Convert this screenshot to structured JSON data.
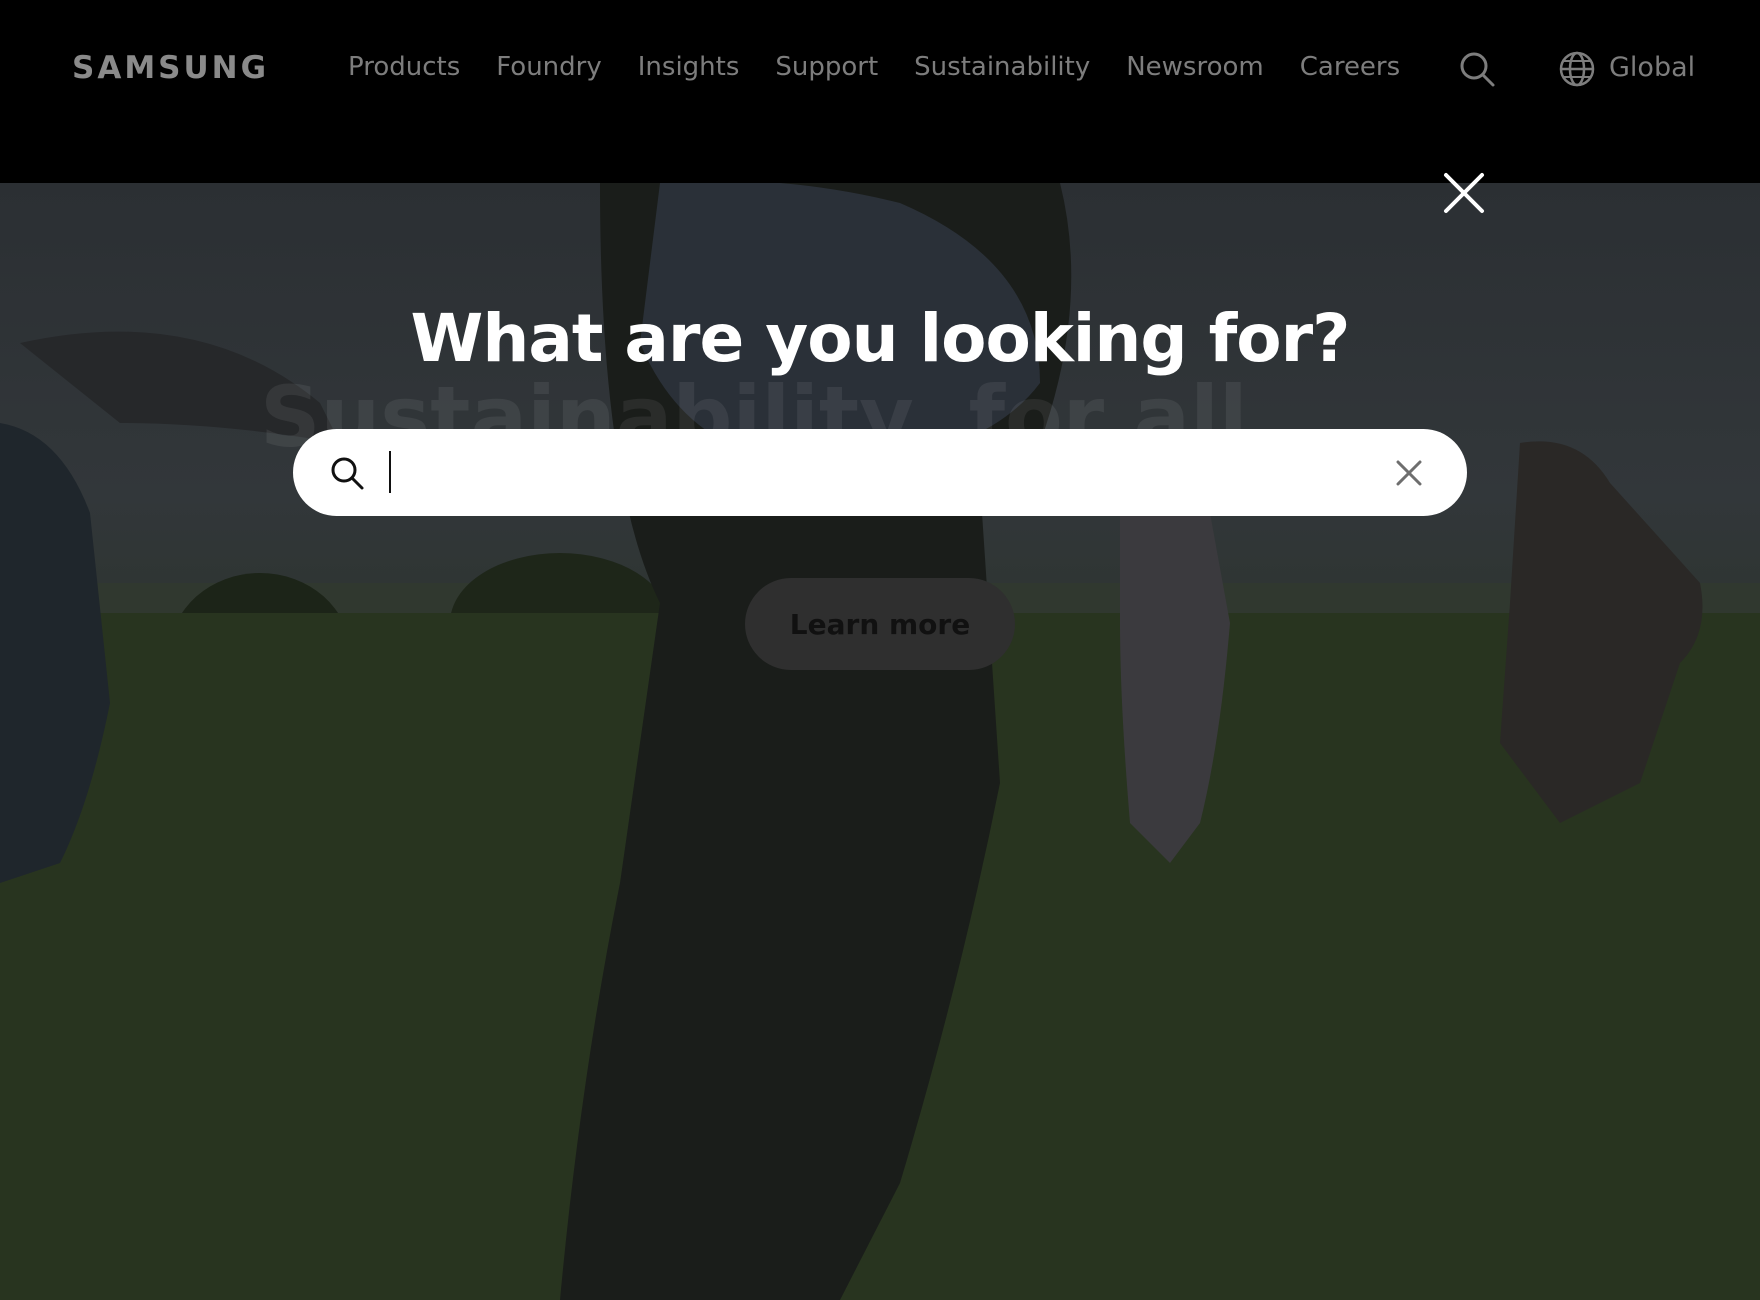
{
  "header": {
    "logo": "SAMSUNG",
    "nav": [
      "Products",
      "Foundry",
      "Insights",
      "Support",
      "Sustainability",
      "Newsroom",
      "Careers"
    ],
    "region_label": "Global"
  },
  "hero": {
    "headline": "Sustainability, for all",
    "cta_label": "Learn more"
  },
  "search_overlay": {
    "title": "What are you looking for?",
    "input_value": "",
    "input_placeholder": ""
  },
  "icons": {
    "header_search": "search-icon",
    "region": "globe-icon",
    "overlay_close": "close-icon",
    "input_search": "search-icon",
    "input_clear": "clear-icon"
  },
  "colors": {
    "header_bg": "#000000",
    "nav_text": "#7d7d7d",
    "search_box_bg": "#ffffff",
    "title_text": "#ffffff"
  }
}
